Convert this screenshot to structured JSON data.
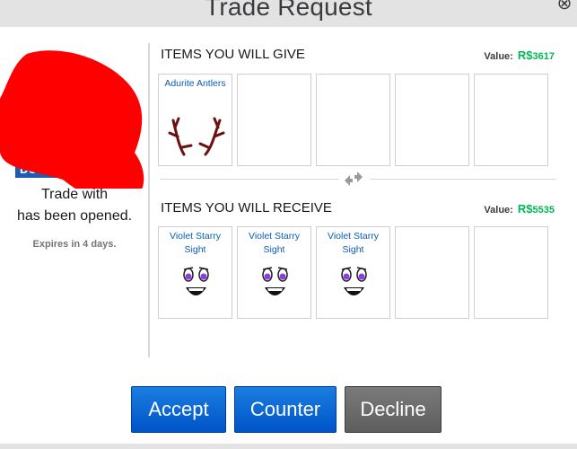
{
  "dialog": {
    "title": "Trade Request",
    "close_glyph": "⊗"
  },
  "left": {
    "line1": "Trade with",
    "line2": "has been opened.",
    "expires": "Expires in 4 days.",
    "avatar_badge_text": "DC",
    "redaction_color": "#ff0000"
  },
  "give": {
    "title": "ITEMS YOU WILL GIVE",
    "value_label": "Value:",
    "currency_icon": "robux-icon",
    "value_amount": "3617",
    "items": [
      {
        "name": "Adurite Antlers",
        "icon": "antlers-icon"
      },
      {
        "name": "",
        "icon": ""
      },
      {
        "name": "",
        "icon": ""
      },
      {
        "name": "",
        "icon": ""
      },
      {
        "name": "",
        "icon": ""
      }
    ]
  },
  "receive": {
    "title": "ITEMS YOU WILL RECEIVE",
    "value_label": "Value:",
    "currency_icon": "robux-icon",
    "value_amount": "5535",
    "items": [
      {
        "name": "Violet Starry Sight",
        "icon": "face-icon"
      },
      {
        "name": "Violet Starry Sight",
        "icon": "face-icon"
      },
      {
        "name": "Violet Starry Sight",
        "icon": "face-icon"
      },
      {
        "name": "",
        "icon": ""
      },
      {
        "name": "",
        "icon": ""
      }
    ]
  },
  "buttons": {
    "accept": "Accept",
    "counter": "Counter",
    "decline": "Decline"
  },
  "colors": {
    "primary_button": "#0054c8",
    "secondary_button": "#5e5e5e",
    "robux_green": "#02b757",
    "item_link": "#0a5cb5"
  }
}
